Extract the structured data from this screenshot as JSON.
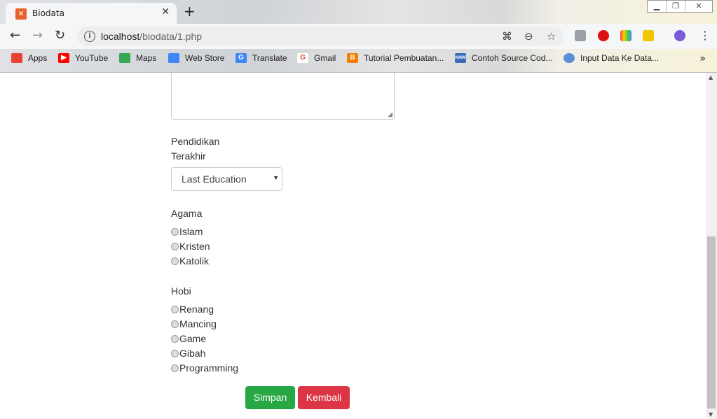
{
  "browser": {
    "tab_title": "Biodata",
    "new_tab_icon": "+",
    "url_host": "localhost",
    "url_path": "/biodata/1.php"
  },
  "bookmarks": [
    {
      "label": "Apps",
      "icon": "apps-grid-icon",
      "color": "#e94235"
    },
    {
      "label": "YouTube",
      "icon": "youtube-icon",
      "color": "#ff0000"
    },
    {
      "label": "Maps",
      "icon": "maps-icon",
      "color": "#34a853"
    },
    {
      "label": "Web Store",
      "icon": "web-store-icon",
      "color": "#4285f4"
    },
    {
      "label": "Translate",
      "icon": "translate-icon",
      "color": "#4285f4"
    },
    {
      "label": "Gmail",
      "icon": "google-icon",
      "color": "#ea4335"
    },
    {
      "label": "Tutorial Pembuatan...",
      "icon": "blogger-icon",
      "color": "#f57d00"
    },
    {
      "label": "Contoh Source Cod...",
      "icon": "kmw-icon",
      "color": "#3b6cb4"
    },
    {
      "label": "Input Data Ke Data...",
      "icon": "link-icon",
      "color": "#5b8fd8"
    }
  ],
  "form": {
    "education_label_line1": "Pendidikan",
    "education_label_line2": "Terakhir",
    "education_select_value": "Last Education",
    "religion_label": "Agama",
    "religion_options": [
      "Islam",
      "Kristen",
      "Katolik"
    ],
    "hobby_label": "Hobi",
    "hobby_options": [
      "Renang",
      "Mancing",
      "Game",
      "Gibah",
      "Programming"
    ],
    "save_label": "Simpan",
    "back_label": "Kembali"
  },
  "colors": {
    "save_button": "#28a745",
    "back_button": "#dc3545"
  }
}
